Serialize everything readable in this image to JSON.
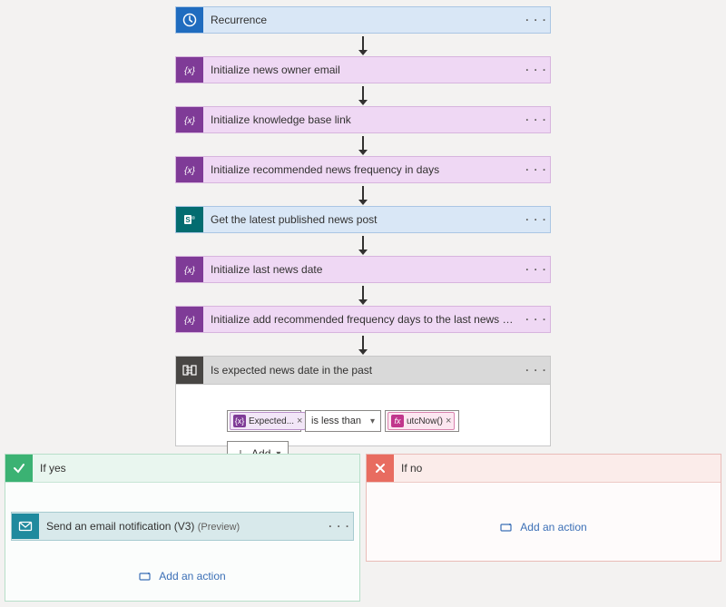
{
  "nodes": {
    "recurrence": "Recurrence",
    "init_owner": "Initialize news owner email",
    "init_kb": "Initialize knowledge base link",
    "init_freq": "Initialize recommended news frequency in days",
    "get_latest": "Get the latest published news post",
    "init_last": "Initialize last news date",
    "init_add": "Initialize add recommended frequency days to the last news date"
  },
  "condition": {
    "title": "Is expected news date in the past",
    "left_chip": "Expected...",
    "operator": "is less than",
    "right_chip": "utcNow()",
    "add_label": "Add"
  },
  "branches": {
    "yes_title": "If yes",
    "no_title": "If no",
    "add_action": "Add an action"
  },
  "email_action": {
    "title": "Send an email notification (V3) ",
    "preview": "(Preview)"
  },
  "misc": {
    "more": "· · ·"
  }
}
